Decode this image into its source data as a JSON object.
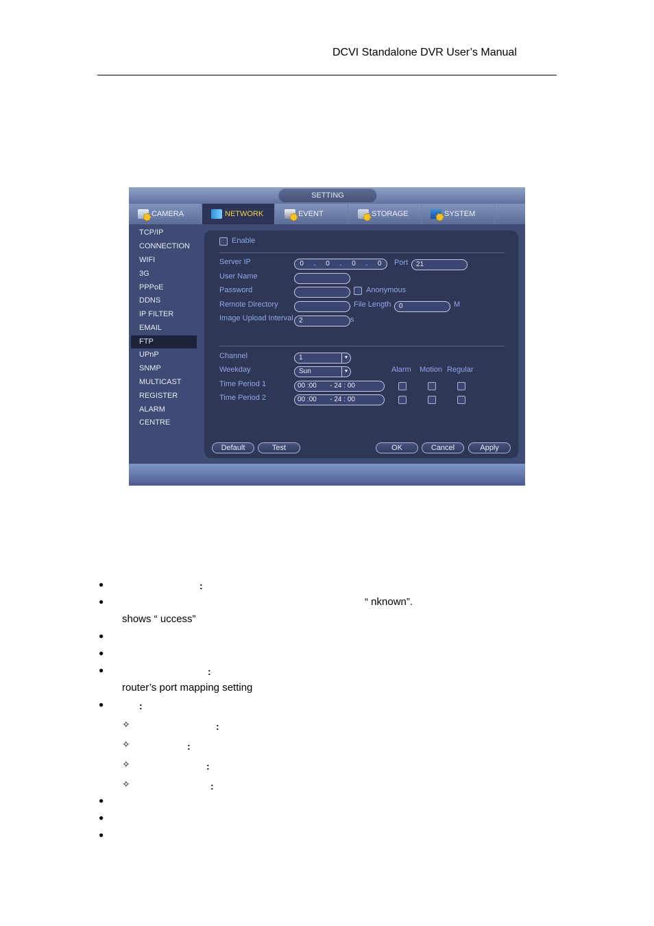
{
  "page_header": {
    "title": "DCVI Standalone DVR User’s Manual"
  },
  "dvr": {
    "window_title": "SETTING",
    "tabs": [
      {
        "label": "CAMERA",
        "icon": "camera-settings-icon",
        "active": false
      },
      {
        "label": "NETWORK",
        "icon": "network-icon",
        "active": true
      },
      {
        "label": "EVENT",
        "icon": "event-settings-icon",
        "active": false
      },
      {
        "label": "STORAGE",
        "icon": "storage-settings-icon",
        "active": false
      },
      {
        "label": "SYSTEM",
        "icon": "system-settings-icon",
        "active": false
      }
    ],
    "sidebar": {
      "items": [
        "TCP/IP",
        "CONNECTION",
        "WIFI",
        "3G",
        "PPPoE",
        "DDNS",
        "IP FILTER",
        "EMAIL",
        "FTP",
        "UPnP",
        "SNMP",
        "MULTICAST",
        "REGISTER",
        "ALARM CENTRE"
      ],
      "active": "FTP"
    },
    "form": {
      "enable_label": "Enable",
      "enable_checked": false,
      "server_ip_label": "Server IP",
      "server_ip": [
        "0",
        "0",
        "0",
        "0"
      ],
      "ip_separator": ".",
      "port_label": "Port",
      "port_value": "21",
      "user_name_label": "User Name",
      "user_name_value": "",
      "password_label": "Password",
      "password_value": "",
      "anonymous_label": "Anonymous",
      "anonymous_checked": false,
      "remote_directory_label": "Remote Directory",
      "remote_directory_value": "",
      "file_length_label": "File Length",
      "file_length_value": "0",
      "file_length_unit": "M",
      "image_upload_interval_label": "Image Upload Interval",
      "image_upload_interval_value": "2",
      "image_upload_interval_unit": "s",
      "channel_label": "Channel",
      "channel_value": "1",
      "weekday_label": "Weekday",
      "weekday_value": "Sun",
      "col_alarm": "Alarm",
      "col_motion": "Motion",
      "col_regular": "Regular",
      "periods": [
        {
          "label": "Time Period 1",
          "start_h": "00",
          "start_m": "00",
          "end_h": "24",
          "end_m": "00",
          "alarm": false,
          "motion": false,
          "regular": false
        },
        {
          "label": "Time Period 2",
          "start_h": "00",
          "start_m": "00",
          "end_h": "24",
          "end_m": "00",
          "alarm": false,
          "motion": false,
          "regular": false
        }
      ]
    },
    "buttons": {
      "default": "Default",
      "test": "Test",
      "ok": "OK",
      "cancel": "Cancel",
      "apply": "Apply"
    }
  },
  "body_text": {
    "line2_right": "“   nknown”.",
    "line2_cont": "shows “   uccess”",
    "line5_cont": "router’s port mapping setting",
    "bullet_glyph": "●",
    "sub_bullet_glyph": "✧",
    "colon": ":"
  }
}
